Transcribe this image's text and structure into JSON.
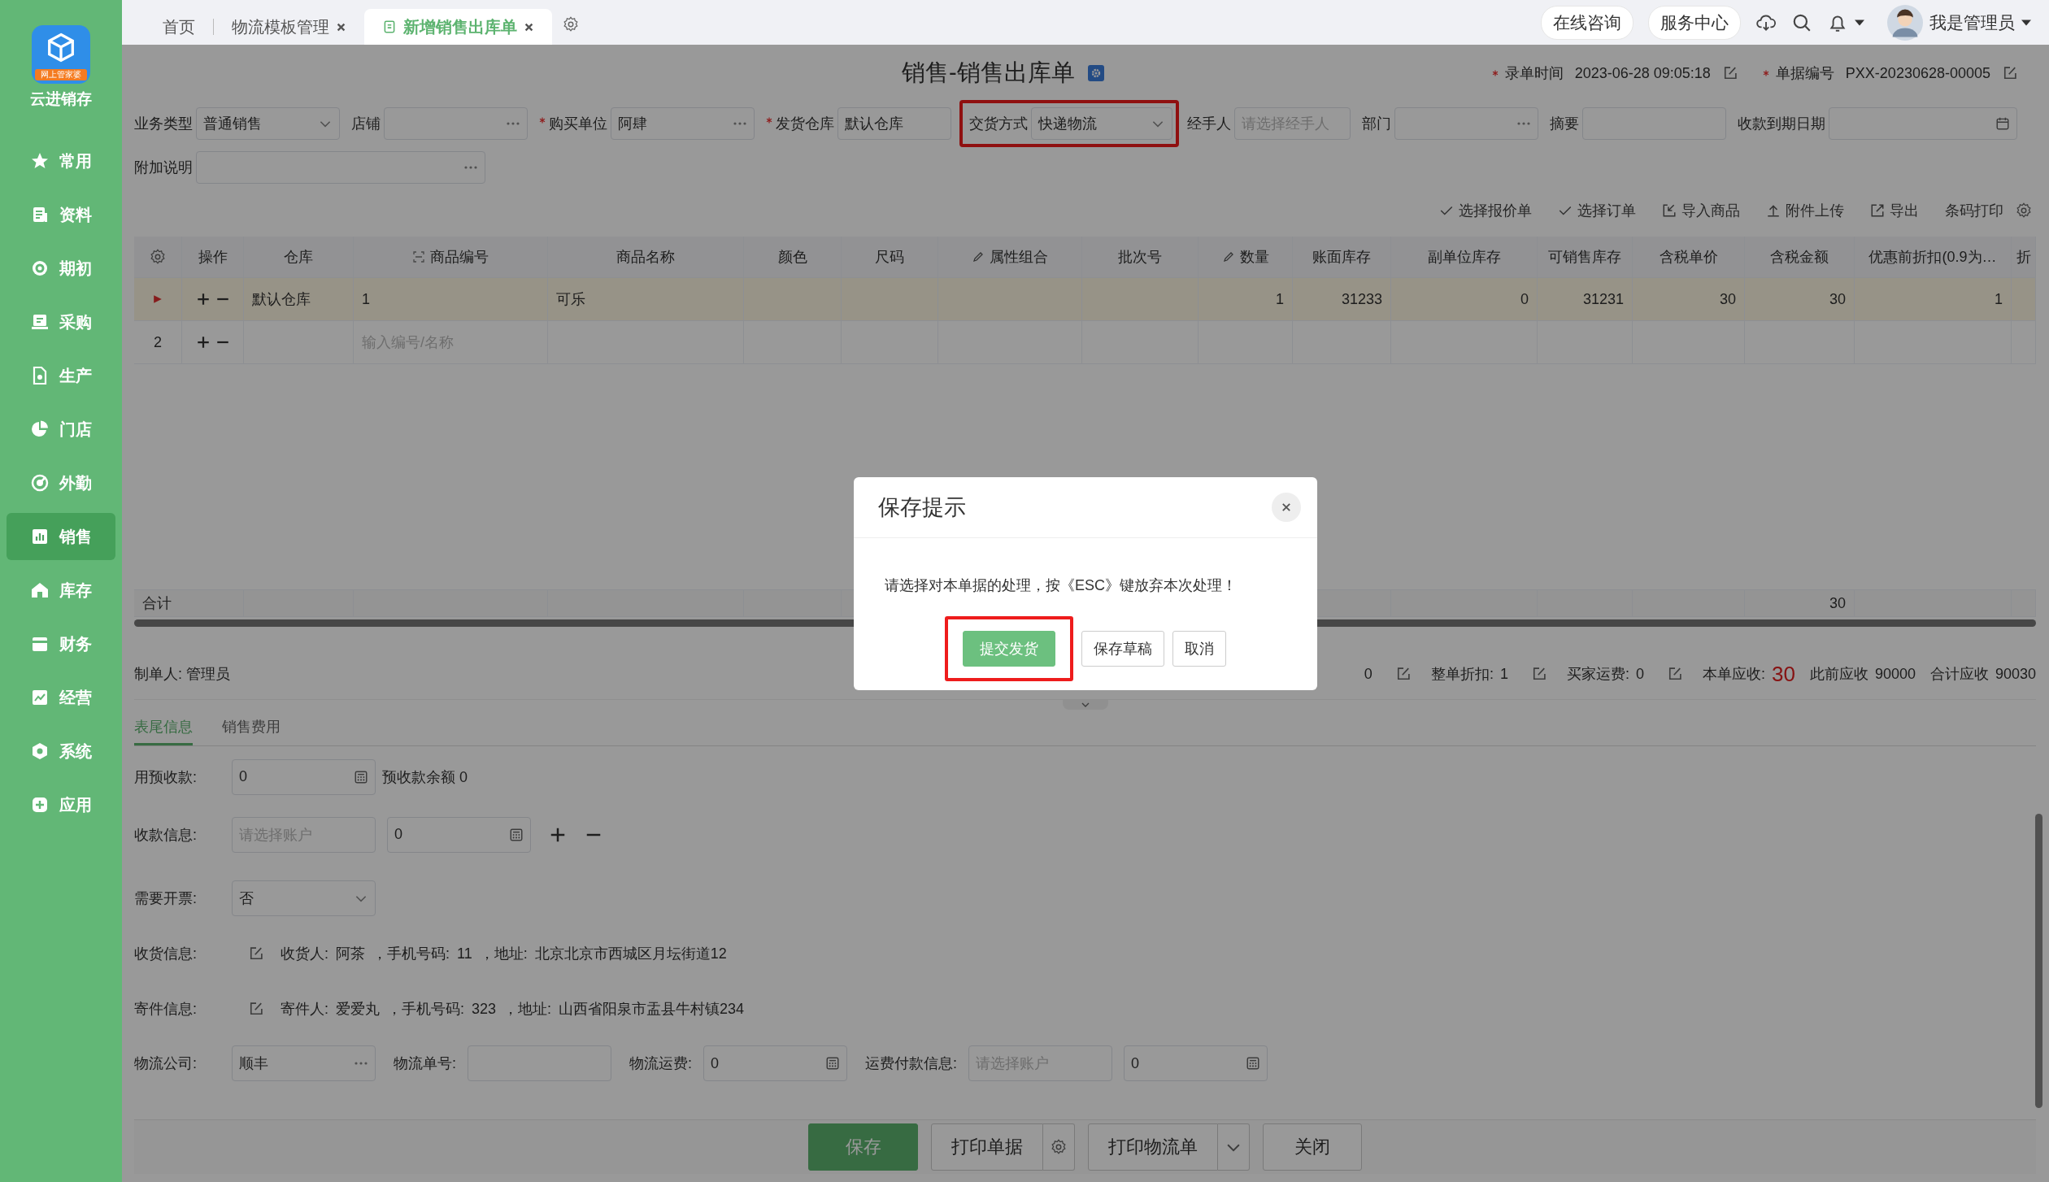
{
  "sidebar": {
    "logo_badge": "网上管家婆",
    "logo_text": "云进销存",
    "items": [
      {
        "label": "常用",
        "selected": false
      },
      {
        "label": "资料",
        "selected": false
      },
      {
        "label": "期初",
        "selected": false
      },
      {
        "label": "采购",
        "selected": false
      },
      {
        "label": "生产",
        "selected": false
      },
      {
        "label": "门店",
        "selected": false
      },
      {
        "label": "外勤",
        "selected": false
      },
      {
        "label": "销售",
        "selected": true
      },
      {
        "label": "库存",
        "selected": false
      },
      {
        "label": "财务",
        "selected": false
      },
      {
        "label": "经营",
        "selected": false
      },
      {
        "label": "系统",
        "selected": false
      },
      {
        "label": "应用",
        "selected": false
      }
    ]
  },
  "tabs": [
    {
      "label": "首页",
      "selected": false,
      "closable": false
    },
    {
      "label": "物流模板管理",
      "selected": false,
      "closable": true
    },
    {
      "label": "新增销售出库单",
      "selected": true,
      "closable": true
    }
  ],
  "header": {
    "links": [
      "在线咨询",
      "服务中心"
    ],
    "user": "我是管理员"
  },
  "form": {
    "title": "销售-销售出库单",
    "meta": [
      {
        "label": "录单时间",
        "value": "2023-06-28 09:05:18",
        "required": true
      },
      {
        "label": "单据编号",
        "value": "PXX-20230628-00005",
        "required": true
      }
    ],
    "rows": [
      [
        {
          "label": "业务类型",
          "value": "普通销售",
          "kind": "select",
          "required": false,
          "highlighted": false
        },
        {
          "label": "店铺",
          "kind": "dots",
          "required": false,
          "highlighted": false
        },
        {
          "label": "购买单位",
          "value": "阿肆",
          "kind": "dots",
          "required": true,
          "highlighted": false
        },
        {
          "label": "发货仓库",
          "value": "默认仓库",
          "kind": "input",
          "required": true,
          "highlighted": false
        },
        {
          "label": "交货方式",
          "value": "快递物流",
          "kind": "select",
          "required": false,
          "highlighted": true
        },
        {
          "label": "经手人",
          "placeholder": "请选择经手人",
          "kind": "input",
          "required": false,
          "highlighted": false
        },
        {
          "label": "部门",
          "kind": "dots",
          "required": false,
          "highlighted": false
        },
        {
          "label": "摘要",
          "kind": "input",
          "required": false,
          "highlighted": false
        },
        {
          "label": "收款到期日期",
          "kind": "date",
          "required": false,
          "highlighted": false
        }
      ],
      [
        {
          "label": "附加说明",
          "kind": "dots",
          "required": false,
          "highlighted": false
        }
      ]
    ]
  },
  "toolbar": [
    {
      "label": "选择报价单",
      "kind": "check"
    },
    {
      "label": "选择订单",
      "kind": "check"
    },
    {
      "label": "导入商品",
      "kind": "import"
    },
    {
      "label": "附件上传",
      "kind": "upload"
    },
    {
      "label": "导出",
      "kind": "export"
    },
    {
      "label": "条码打印",
      "kind": "plain"
    }
  ],
  "table": {
    "ops_label": "操作",
    "columns": [
      {
        "label": "仓库",
        "kind": "plain"
      },
      {
        "label": "商品编号",
        "kind": "scan"
      },
      {
        "label": "商品名称",
        "kind": "plain"
      },
      {
        "label": "颜色",
        "kind": "plain"
      },
      {
        "label": "尺码",
        "kind": "plain"
      },
      {
        "label": "属性组合",
        "kind": "edit"
      },
      {
        "label": "批次号",
        "kind": "plain"
      },
      {
        "label": "数量",
        "kind": "edit"
      },
      {
        "label": "账面库存",
        "kind": "plain"
      },
      {
        "label": "副单位库存",
        "kind": "plain"
      },
      {
        "label": "可销售库存",
        "kind": "plain"
      },
      {
        "label": "含税单价",
        "kind": "plain"
      },
      {
        "label": "含税金额",
        "kind": "plain"
      },
      {
        "label": "优惠前折扣(0.9为…",
        "kind": "plain"
      },
      {
        "label": "折",
        "kind": "plain"
      }
    ],
    "rows": [
      {
        "current": true,
        "cells": [
          "默认仓库",
          "1",
          "可乐",
          null,
          null,
          null,
          null,
          "1",
          "31233",
          "0",
          "31231",
          "30",
          "30",
          "1",
          null
        ]
      },
      {
        "current": false,
        "index": "2",
        "cells": [
          null,
          {
            "placeholder": "输入编号/名称"
          },
          null,
          null,
          null,
          null,
          null,
          null,
          null,
          null,
          null,
          null,
          null,
          null,
          null
        ]
      }
    ],
    "total": {
      "label": "合计",
      "cells": [
        null,
        null,
        null,
        null,
        null,
        null,
        null,
        null,
        null,
        null,
        null,
        null,
        "30",
        null,
        null
      ]
    }
  },
  "summary": {
    "creator": "制单人: 管理员",
    "items": [
      {
        "value": "0",
        "editable": true,
        "emphasis": false
      },
      {
        "label": "整单折扣:",
        "value": "1",
        "editable": true,
        "emphasis": false
      },
      {
        "label": "买家运费:",
        "value": "0",
        "editable": true,
        "emphasis": false
      },
      {
        "label": "本单应收:",
        "value": "30",
        "editable": false,
        "emphasis": true
      },
      {
        "label": "此前应收",
        "value": "90000",
        "editable": false,
        "emphasis": false
      },
      {
        "label": "合计应收",
        "value": "90030",
        "editable": false,
        "emphasis": false
      }
    ]
  },
  "bottom": {
    "tabs": [
      {
        "label": "表尾信息",
        "selected": true
      },
      {
        "label": "销售费用",
        "selected": false
      }
    ],
    "rows": [
      {
        "label": "用预收款:",
        "fields": [
          {
            "kind": "calc",
            "value": "0"
          }
        ],
        "note": "预收款余额 0"
      },
      {
        "label": "收款信息:",
        "fields": [
          {
            "kind": "input",
            "placeholder": "请选择账户"
          },
          {
            "kind": "calc",
            "value": "0"
          }
        ],
        "adjustable": true
      },
      {
        "label": "需要开票:",
        "fields": [
          {
            "kind": "select",
            "value": "否"
          }
        ]
      },
      {
        "label": "收货信息:",
        "info": "收货人: 阿茶 ，手机号码: 11 ，地址: 北京北京市西城区月坛街道12"
      },
      {
        "label": "寄件信息:",
        "info": "寄件人: 爱爱丸 ，手机号码: 323 ，地址: 山西省阳泉市盂县牛村镇234"
      },
      {
        "label": "物流公司:",
        "fields": [
          {
            "kind": "dots",
            "value": "顺丰"
          },
          {
            "label": "物流单号:",
            "kind": "input"
          },
          {
            "label": "物流运费:",
            "kind": "calc",
            "value": "0"
          },
          {
            "label": "运费付款信息:",
            "kind": "input",
            "placeholder": "请选择账户"
          },
          {
            "kind": "calc",
            "value": "0"
          }
        ]
      }
    ]
  },
  "footer": [
    {
      "label": "保存",
      "kind": "primary"
    },
    {
      "label": "打印单据",
      "kind": "split-settings"
    },
    {
      "label": "打印物流单",
      "kind": "split-menu"
    },
    {
      "label": "关闭",
      "kind": "default"
    }
  ],
  "modal": {
    "title": "保存提示",
    "message": "请选择对本单据的处理，按《ESC》键放弃本次处理！",
    "buttons": [
      {
        "label": "提交发货",
        "kind": "primary",
        "highlighted": true
      },
      {
        "label": "保存草稿",
        "kind": "default",
        "highlighted": false
      },
      {
        "label": "取消",
        "kind": "default",
        "highlighted": false
      }
    ]
  }
}
